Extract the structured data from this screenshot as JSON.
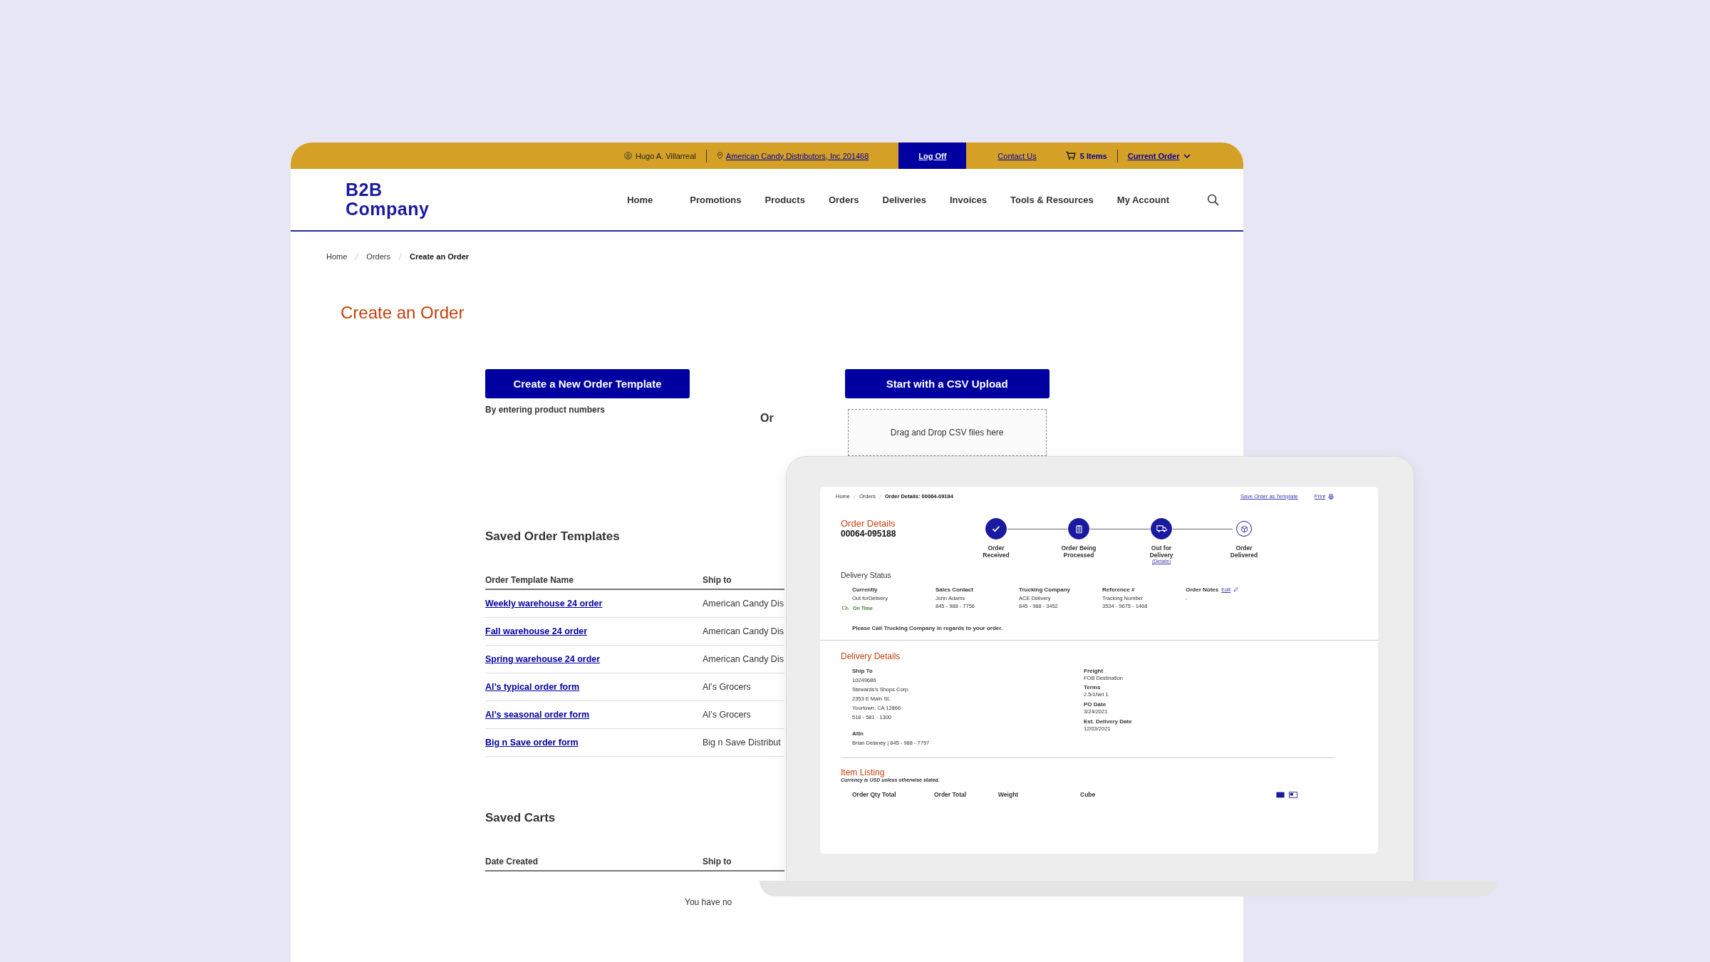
{
  "top_bar": {
    "user": "Hugo A. Villarreal",
    "account": "American Candy Distributors, Inc 201468",
    "log_off": "Log Off",
    "contact_us": "Contact Us",
    "cart": "5 Items",
    "current_order": "Current Order"
  },
  "logo": [
    "B2B",
    "Company"
  ],
  "nav": [
    "Home",
    "Promotions",
    "Products",
    "Orders",
    "Deliveries",
    "Invoices",
    "Tools & Resources",
    "My Account"
  ],
  "breadcrumb": [
    {
      "label": "Home",
      "current": false
    },
    {
      "label": "Orders",
      "current": false
    },
    {
      "label": "Create an Order",
      "current": true
    }
  ],
  "title": "Create an Order",
  "start": {
    "template_button": "Create a New Order Template",
    "template_note": "By entering product numbers",
    "or": "Or",
    "csv_button": "Start with a CSV Upload",
    "drop_zone": "Drag and Drop CSV files here"
  },
  "saved_templates": {
    "heading": "Saved Order Templates",
    "columns": [
      "Order Template Name",
      "Ship to"
    ],
    "rows": [
      {
        "name": "Weekly warehouse 24 order",
        "ship_to": "American Candy Dis"
      },
      {
        "name": "Fall warehouse 24 order",
        "ship_to": "American Candy Dis"
      },
      {
        "name": "Spring warehouse 24 order",
        "ship_to": "American Candy Dis"
      },
      {
        "name": "Al’s typical order form",
        "ship_to": "Al’s Grocers"
      },
      {
        "name": "Al’s seasonal order form",
        "ship_to": "Al’s Grocers"
      },
      {
        "name": "Big n Save order form",
        "ship_to": "Big n Save Distribut"
      }
    ]
  },
  "saved_carts": {
    "heading": "Saved Carts",
    "columns": [
      "Date Created",
      "Ship to"
    ],
    "empty": "You have no"
  },
  "laptop": {
    "breadcrumb": [
      {
        "label": "Home",
        "current": false
      },
      {
        "label": "Orders",
        "current": false
      },
      {
        "label": "Order Details:  00064-09184",
        "current": true
      }
    ],
    "save_template": "Save Order as Template",
    "print": "Print",
    "order_title": "Order Details",
    "order_number": "00064-095188",
    "steps": [
      {
        "kind": "check",
        "lines": [
          "Order",
          "Received"
        ],
        "completed": true
      },
      {
        "kind": "clipboard",
        "lines": [
          "Order Being",
          "Processed"
        ],
        "completed": true
      },
      {
        "kind": "truck",
        "lines": [
          "Out for",
          "Delivery"
        ],
        "link": "(Details)",
        "completed": true
      },
      {
        "kind": "box",
        "lines": [
          "Order",
          "Delivered"
        ],
        "completed": false
      }
    ],
    "status_heading": "Delivery Status",
    "status_fields": [
      {
        "label": "Currently",
        "lines": [
          "Out forDelivery"
        ],
        "badge": "On Time"
      },
      {
        "label": "Sales Contact",
        "lines": [
          "John Adams",
          "845 - 988 - 7756"
        ]
      },
      {
        "label": "Trucking Company",
        "lines": [
          "ACE Delivery",
          "845 - 988 - 3452"
        ]
      },
      {
        "label": "Reference #",
        "lines": [
          "Tracking Number",
          "3534 - 9675 - 1468"
        ]
      },
      {
        "label": "Order Notes",
        "lines": [
          "-"
        ],
        "edit": "Edit"
      }
    ],
    "message": "Please Call Trucking Company in regards to your order.",
    "details_heading": "Delivery Details",
    "details_left": [
      {
        "label": "Ship To",
        "lines": [
          "10249686",
          "Stewards’s Shops Corp.",
          "2353 E Main St.",
          "Yourtown, CA 12866",
          "518 - 581 - 1300"
        ]
      },
      {
        "label": "Attn",
        "lines": [
          "Brian Delaney |  845 - 988 - 7757"
        ]
      }
    ],
    "details_right": [
      {
        "label": "Freight",
        "lines": [
          "FOB Destination"
        ]
      },
      {
        "label": "Terms",
        "lines": [
          "2.5/1Net 1"
        ]
      },
      {
        "label": "PO Date",
        "lines": [
          "3/24/2021"
        ]
      },
      {
        "label": "Est. Delivery Date",
        "lines": [
          "12/03/2021"
        ]
      }
    ],
    "items_heading": "Item Listing",
    "items_note": "Currency is USD unless otherwise stated.",
    "items_columns": [
      "Order Qty Total",
      "Order Total",
      "Weight",
      "Cube"
    ]
  }
}
